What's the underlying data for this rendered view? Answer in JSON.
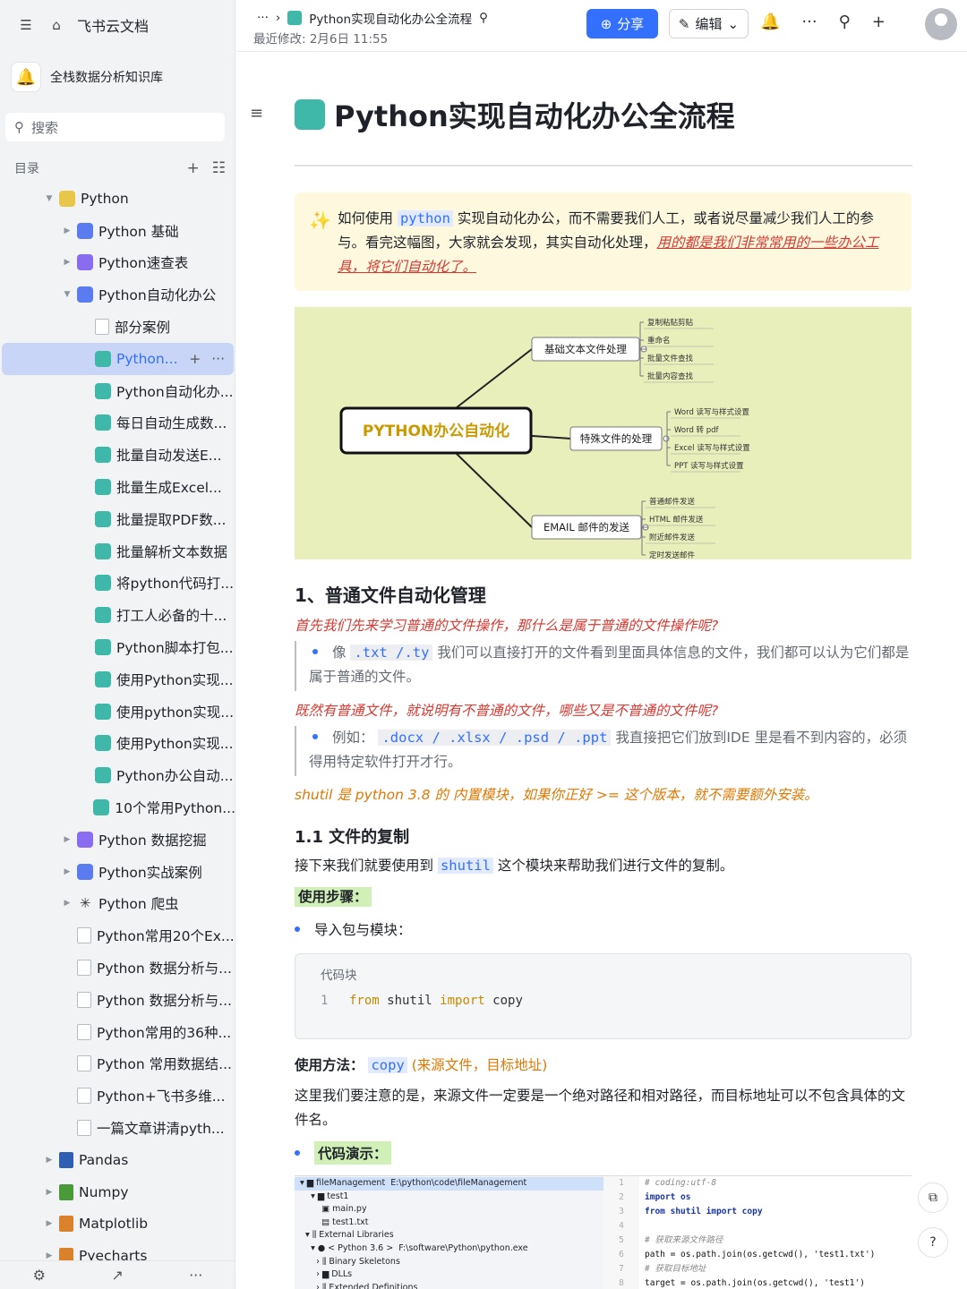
{
  "sidebar": {
    "app_name": "飞书云文档",
    "kb_name": "全栈数据分析知识库",
    "search_placeholder": "搜索",
    "toc_label": "目录",
    "tree": [
      {
        "label": "Python",
        "depth": 0,
        "arrow": "down",
        "icon": "py"
      },
      {
        "label": "Python 基础",
        "depth": 1,
        "arrow": "right",
        "icon": "blue"
      },
      {
        "label": "Python速查表",
        "depth": 1,
        "arrow": "right",
        "icon": "purple"
      },
      {
        "label": "Python自动化办公",
        "depth": 1,
        "arrow": "down",
        "icon": "blue"
      },
      {
        "label": "部分案例",
        "depth": 2,
        "arrow": "",
        "icon": "page"
      },
      {
        "label": "Python...",
        "depth": 2,
        "arrow": "",
        "icon": "doc",
        "selected": true
      },
      {
        "label": "Python自动化办...",
        "depth": 2,
        "arrow": "",
        "icon": "doc"
      },
      {
        "label": "每日自动生成数...",
        "depth": 2,
        "arrow": "",
        "icon": "doc"
      },
      {
        "label": "批量自动发送E...",
        "depth": 2,
        "arrow": "",
        "icon": "doc"
      },
      {
        "label": "批量生成Excel...",
        "depth": 2,
        "arrow": "",
        "icon": "doc"
      },
      {
        "label": "批量提取PDF数...",
        "depth": 2,
        "arrow": "",
        "icon": "doc"
      },
      {
        "label": "批量解析文本数据",
        "depth": 2,
        "arrow": "",
        "icon": "doc"
      },
      {
        "label": "将python代码打...",
        "depth": 2,
        "arrow": "",
        "icon": "doc"
      },
      {
        "label": "打工人必备的十...",
        "depth": 2,
        "arrow": "",
        "icon": "doc"
      },
      {
        "label": "Python脚本打包...",
        "depth": 2,
        "arrow": "",
        "icon": "doc"
      },
      {
        "label": "使用Python实现...",
        "depth": 2,
        "arrow": "",
        "icon": "doc"
      },
      {
        "label": "使用python实现...",
        "depth": 2,
        "arrow": "",
        "icon": "doc"
      },
      {
        "label": "使用Python实现...",
        "depth": 2,
        "arrow": "",
        "icon": "doc"
      },
      {
        "label": "Python办公自动...",
        "depth": 2,
        "arrow": "",
        "icon": "doc"
      },
      {
        "label": "10个常用Python...",
        "depth": 2,
        "arrow": "",
        "icon": "doc"
      },
      {
        "label": "Python 数据挖掘",
        "depth": 1,
        "arrow": "right",
        "icon": "purple"
      },
      {
        "label": "Python实战案例",
        "depth": 1,
        "arrow": "right",
        "icon": "blue"
      },
      {
        "label": "Python 爬虫",
        "depth": 1,
        "arrow": "right",
        "icon": "spider"
      },
      {
        "label": "Python常用20个Ex...",
        "depth": 1,
        "arrow": "",
        "icon": "page"
      },
      {
        "label": "Python 数据分析与...",
        "depth": 1,
        "arrow": "",
        "icon": "page"
      },
      {
        "label": "Python 数据分析与...",
        "depth": 1,
        "arrow": "",
        "icon": "page"
      },
      {
        "label": "Python常用的36种...",
        "depth": 1,
        "arrow": "",
        "icon": "page"
      },
      {
        "label": "Python 常用数据结...",
        "depth": 1,
        "arrow": "",
        "icon": "page"
      },
      {
        "label": "Python+飞书多维...",
        "depth": 1,
        "arrow": "",
        "icon": "page"
      },
      {
        "label": "一篇文章讲清pyth...",
        "depth": 1,
        "arrow": "",
        "icon": "page"
      },
      {
        "label": "Pandas",
        "depth": 0,
        "arrow": "right",
        "icon": "book-blue"
      },
      {
        "label": "Numpy",
        "depth": 0,
        "arrow": "right",
        "icon": "book-green"
      },
      {
        "label": "Matplotlib",
        "depth": 0,
        "arrow": "right",
        "icon": "book-orange"
      },
      {
        "label": "Pyecharts",
        "depth": 0,
        "arrow": "right",
        "icon": "book-orange"
      }
    ]
  },
  "header": {
    "breadcrumb_more": "···",
    "doc_title": "Python实现自动化办公全流程",
    "modified": "最近修改: 2月6日 11:55",
    "share_label": "分享",
    "edit_label": "编辑"
  },
  "doc": {
    "title": "Python实现自动化办公全流程",
    "callout_before": "如何使用",
    "callout_code": "python",
    "callout_mid": "实现自动化办公，而不需要我们人工，或者说尽量减少我们人工的参与。看完这幅图，大家就会发现，其实自动化处理，",
    "callout_link": "用的都是我们非常常用的一些办公工具，将它们自动化了。",
    "mindmap": {
      "center": "PYTHON办公自动化",
      "branches": [
        {
          "label": "基础文本文件处理",
          "leaves": [
            "复制粘贴剪贴",
            "重命名",
            "批量文件查找",
            "批量内容查找"
          ]
        },
        {
          "label": "特殊文件的处理",
          "leaves": [
            "Word 读写与样式设置",
            "Word 转 pdf",
            "Excel 读写与样式设置",
            "PPT 读写与样式设置"
          ]
        },
        {
          "label": "EMAIL 邮件的发送",
          "leaves": [
            "普通邮件发送",
            "HTML 邮件发送",
            "附近邮件发送",
            "定时发送邮件"
          ]
        }
      ]
    },
    "h1": "1、普通文件自动化管理",
    "q1": "首先我们先来学习普通的文件操作，那什么是属于普通的文件操作呢?",
    "b1_pre": "像",
    "b1_code": ".txt /.ty",
    "b1_post": "我们可以直接打开的文件看到里面具体信息的文件，我们都可以认为它们都是属于普通的文件。",
    "q2": "既然有普通文件，就说明有不普通的文件，哪些又是不普通的文件呢?",
    "b2_pre": "例如：",
    "b2_code": ".docx / .xlsx / .psd / .ppt",
    "b2_post": "我直接把它们放到IDE 里是看不到内容的，必须得用特定软件打开才行。",
    "q3": "shutil 是 python 3.8 的 内置模块，如果你正好 >= 这个版本，就不需要额外安装。",
    "h2": "1.1 文件的复制",
    "p1_pre": "接下来我们就要使用到",
    "p1_code": "shutil",
    "p1_post": "这个模块来帮助我们进行文件的复制。",
    "steps_label": "使用步骤：",
    "step1": "导入包与模块：",
    "codeblock_label": "代码块",
    "code_line_no": "1",
    "code_from": "from",
    "code_mod": " shutil ",
    "code_import": "import",
    "code_name": " copy",
    "usage_label": "使用方法：",
    "usage_code": "copy",
    "usage_args": "(来源文件，目标地址)",
    "p2": "这里我们要注意的是，来源文件一定要是一个绝对路径和相对路径，而目标地址可以不包含具体的文件名。",
    "demo_label": "代码演示："
  },
  "ide": {
    "tree": [
      "▾ ▆ fileManagement  E:\\python\\code\\fileManagement",
      "    ▾ ▆ test1",
      "        ▣ main.py",
      "        ▤ test1.txt",
      "  ▾ ⫼ External Libraries",
      "    ▾ ● < Python 3.6 >  F:\\software\\Python\\python.exe",
      "      › ⫼ Binary Skeletons",
      "      › ▆ DLLs",
      "      › ⫼ Extended Definitions"
    ],
    "line_numbers": [
      "1",
      "2",
      "3",
      "4",
      "5",
      "6",
      "7",
      "8"
    ],
    "src": [
      [
        "cm",
        "# coding:utf-8"
      ],
      [
        "kw",
        "import os"
      ],
      [
        "kw",
        "from shutil import copy"
      ],
      [
        "",
        ""
      ],
      [
        "cm",
        "# 获取来源文件路径"
      ],
      [
        "",
        "path = os.path.join(os.getcwd(), 'test1.txt')"
      ],
      [
        "cm",
        "# 获取目标地址"
      ],
      [
        "",
        "target = os.path.join(os.getcwd(), 'test1')"
      ]
    ]
  }
}
